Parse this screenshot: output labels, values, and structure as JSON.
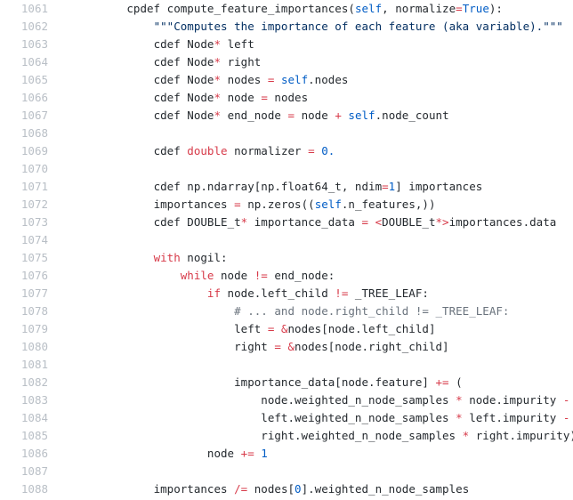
{
  "editor": {
    "language": "cython",
    "background_color": "#ffffff",
    "line_number_color": "#b9bfc6",
    "colors": {
      "keyword": "#d73a49",
      "operator": "#d73a49",
      "number": "#005cc5",
      "builtin": "#005cc5",
      "string": "#032f62",
      "comment": "#6a737d",
      "text": "#24292e"
    },
    "first_line": 1061,
    "last_line": 1088
  },
  "lines": [
    {
      "number": "1061",
      "tokens": [
        {
          "t": "        ",
          "c": "plain"
        },
        {
          "t": "cpdef",
          "c": "plain"
        },
        {
          "t": " compute_feature_importances(",
          "c": "plain"
        },
        {
          "t": "self",
          "c": "blue"
        },
        {
          "t": ", normalize",
          "c": "plain"
        },
        {
          "t": "=",
          "c": "op"
        },
        {
          "t": "True",
          "c": "blue"
        },
        {
          "t": "):",
          "c": "plain"
        }
      ]
    },
    {
      "number": "1062",
      "tokens": [
        {
          "t": "            ",
          "c": "plain"
        },
        {
          "t": "\"\"\"Computes the importance of each feature (aka variable).\"\"\"",
          "c": "str"
        }
      ]
    },
    {
      "number": "1063",
      "tokens": [
        {
          "t": "            ",
          "c": "plain"
        },
        {
          "t": "cdef Node",
          "c": "plain"
        },
        {
          "t": "*",
          "c": "op"
        },
        {
          "t": " left",
          "c": "plain"
        }
      ]
    },
    {
      "number": "1064",
      "tokens": [
        {
          "t": "            ",
          "c": "plain"
        },
        {
          "t": "cdef Node",
          "c": "plain"
        },
        {
          "t": "*",
          "c": "op"
        },
        {
          "t": " right",
          "c": "plain"
        }
      ]
    },
    {
      "number": "1065",
      "tokens": [
        {
          "t": "            ",
          "c": "plain"
        },
        {
          "t": "cdef Node",
          "c": "plain"
        },
        {
          "t": "*",
          "c": "op"
        },
        {
          "t": " nodes ",
          "c": "plain"
        },
        {
          "t": "=",
          "c": "op"
        },
        {
          "t": " ",
          "c": "plain"
        },
        {
          "t": "self",
          "c": "blue"
        },
        {
          "t": ".nodes",
          "c": "plain"
        }
      ]
    },
    {
      "number": "1066",
      "tokens": [
        {
          "t": "            ",
          "c": "plain"
        },
        {
          "t": "cdef Node",
          "c": "plain"
        },
        {
          "t": "*",
          "c": "op"
        },
        {
          "t": " node ",
          "c": "plain"
        },
        {
          "t": "=",
          "c": "op"
        },
        {
          "t": " nodes",
          "c": "plain"
        }
      ]
    },
    {
      "number": "1067",
      "tokens": [
        {
          "t": "            ",
          "c": "plain"
        },
        {
          "t": "cdef Node",
          "c": "plain"
        },
        {
          "t": "*",
          "c": "op"
        },
        {
          "t": " end_node ",
          "c": "plain"
        },
        {
          "t": "=",
          "c": "op"
        },
        {
          "t": " node ",
          "c": "plain"
        },
        {
          "t": "+",
          "c": "op"
        },
        {
          "t": " ",
          "c": "plain"
        },
        {
          "t": "self",
          "c": "blue"
        },
        {
          "t": ".node_count",
          "c": "plain"
        }
      ]
    },
    {
      "number": "1068",
      "tokens": []
    },
    {
      "number": "1069",
      "tokens": [
        {
          "t": "            ",
          "c": "plain"
        },
        {
          "t": "cdef ",
          "c": "plain"
        },
        {
          "t": "double",
          "c": "kw"
        },
        {
          "t": " normalizer ",
          "c": "plain"
        },
        {
          "t": "=",
          "c": "op"
        },
        {
          "t": " ",
          "c": "plain"
        },
        {
          "t": "0.",
          "c": "num"
        }
      ]
    },
    {
      "number": "1070",
      "tokens": []
    },
    {
      "number": "1071",
      "tokens": [
        {
          "t": "            ",
          "c": "plain"
        },
        {
          "t": "cdef np.ndarray[np.float64_t, ndim",
          "c": "plain"
        },
        {
          "t": "=",
          "c": "op"
        },
        {
          "t": "1",
          "c": "num"
        },
        {
          "t": "] importances",
          "c": "plain"
        }
      ]
    },
    {
      "number": "1072",
      "tokens": [
        {
          "t": "            ",
          "c": "plain"
        },
        {
          "t": "importances ",
          "c": "plain"
        },
        {
          "t": "=",
          "c": "op"
        },
        {
          "t": " np.zeros((",
          "c": "plain"
        },
        {
          "t": "self",
          "c": "blue"
        },
        {
          "t": ".n_features,))",
          "c": "plain"
        }
      ]
    },
    {
      "number": "1073",
      "tokens": [
        {
          "t": "            ",
          "c": "plain"
        },
        {
          "t": "cdef DOUBLE_t",
          "c": "plain"
        },
        {
          "t": "*",
          "c": "op"
        },
        {
          "t": " importance_data ",
          "c": "plain"
        },
        {
          "t": "=",
          "c": "op"
        },
        {
          "t": " ",
          "c": "plain"
        },
        {
          "t": "<",
          "c": "op"
        },
        {
          "t": "DOUBLE_t",
          "c": "plain"
        },
        {
          "t": "*>",
          "c": "op"
        },
        {
          "t": "importances.data",
          "c": "plain"
        }
      ]
    },
    {
      "number": "1074",
      "tokens": []
    },
    {
      "number": "1075",
      "tokens": [
        {
          "t": "            ",
          "c": "plain"
        },
        {
          "t": "with",
          "c": "kw"
        },
        {
          "t": " nogil:",
          "c": "plain"
        }
      ]
    },
    {
      "number": "1076",
      "tokens": [
        {
          "t": "                ",
          "c": "plain"
        },
        {
          "t": "while",
          "c": "kw"
        },
        {
          "t": " node ",
          "c": "plain"
        },
        {
          "t": "!=",
          "c": "op"
        },
        {
          "t": " end_node:",
          "c": "plain"
        }
      ]
    },
    {
      "number": "1077",
      "tokens": [
        {
          "t": "                    ",
          "c": "plain"
        },
        {
          "t": "if",
          "c": "kw"
        },
        {
          "t": " node.left_child ",
          "c": "plain"
        },
        {
          "t": "!=",
          "c": "op"
        },
        {
          "t": " _TREE_LEAF:",
          "c": "plain"
        }
      ]
    },
    {
      "number": "1078",
      "tokens": [
        {
          "t": "                        ",
          "c": "plain"
        },
        {
          "t": "# ... and node.right_child != _TREE_LEAF:",
          "c": "cmt"
        }
      ]
    },
    {
      "number": "1079",
      "tokens": [
        {
          "t": "                        ",
          "c": "plain"
        },
        {
          "t": "left ",
          "c": "plain"
        },
        {
          "t": "=",
          "c": "op"
        },
        {
          "t": " ",
          "c": "plain"
        },
        {
          "t": "&",
          "c": "op"
        },
        {
          "t": "nodes[node.left_child]",
          "c": "plain"
        }
      ]
    },
    {
      "number": "1080",
      "tokens": [
        {
          "t": "                        ",
          "c": "plain"
        },
        {
          "t": "right ",
          "c": "plain"
        },
        {
          "t": "=",
          "c": "op"
        },
        {
          "t": " ",
          "c": "plain"
        },
        {
          "t": "&",
          "c": "op"
        },
        {
          "t": "nodes[node.right_child]",
          "c": "plain"
        }
      ]
    },
    {
      "number": "1081",
      "tokens": []
    },
    {
      "number": "1082",
      "tokens": [
        {
          "t": "                        ",
          "c": "plain"
        },
        {
          "t": "importance_data[node.feature] ",
          "c": "plain"
        },
        {
          "t": "+=",
          "c": "op"
        },
        {
          "t": " (",
          "c": "plain"
        }
      ]
    },
    {
      "number": "1083",
      "tokens": [
        {
          "t": "                            ",
          "c": "plain"
        },
        {
          "t": "node.weighted_n_node_samples ",
          "c": "plain"
        },
        {
          "t": "*",
          "c": "op"
        },
        {
          "t": " node.impurity ",
          "c": "plain"
        },
        {
          "t": "-",
          "c": "op"
        }
      ]
    },
    {
      "number": "1084",
      "tokens": [
        {
          "t": "                            ",
          "c": "plain"
        },
        {
          "t": "left.weighted_n_node_samples ",
          "c": "plain"
        },
        {
          "t": "*",
          "c": "op"
        },
        {
          "t": " left.impurity ",
          "c": "plain"
        },
        {
          "t": "-",
          "c": "op"
        }
      ]
    },
    {
      "number": "1085",
      "tokens": [
        {
          "t": "                            ",
          "c": "plain"
        },
        {
          "t": "right.weighted_n_node_samples ",
          "c": "plain"
        },
        {
          "t": "*",
          "c": "op"
        },
        {
          "t": " right.impurity)",
          "c": "plain"
        }
      ]
    },
    {
      "number": "1086",
      "tokens": [
        {
          "t": "                    ",
          "c": "plain"
        },
        {
          "t": "node ",
          "c": "plain"
        },
        {
          "t": "+=",
          "c": "op"
        },
        {
          "t": " ",
          "c": "plain"
        },
        {
          "t": "1",
          "c": "num"
        }
      ]
    },
    {
      "number": "1087",
      "tokens": []
    },
    {
      "number": "1088",
      "tokens": [
        {
          "t": "            ",
          "c": "plain"
        },
        {
          "t": "importances ",
          "c": "plain"
        },
        {
          "t": "/=",
          "c": "op"
        },
        {
          "t": " nodes[",
          "c": "plain"
        },
        {
          "t": "0",
          "c": "num"
        },
        {
          "t": "].weighted_n_node_samples",
          "c": "plain"
        }
      ]
    }
  ]
}
